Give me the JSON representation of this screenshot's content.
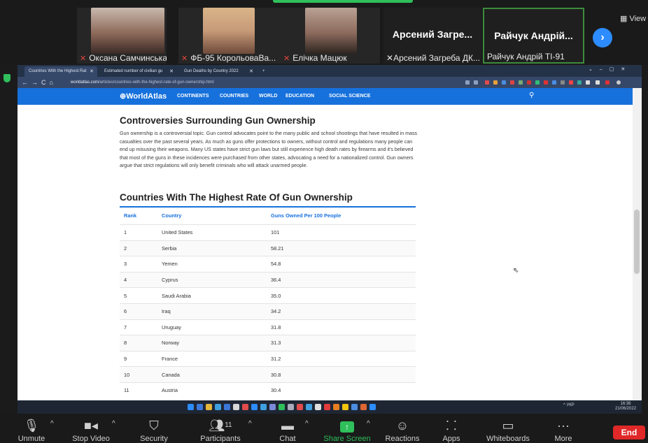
{
  "participants": [
    {
      "name": "Оксана Самчинська",
      "muted": true
    },
    {
      "name": "ФБ-95 КорольоваВа...",
      "muted": true
    },
    {
      "name": "Елічка Мацюк",
      "muted": true
    },
    {
      "name": "Арсений Загреба ДК...",
      "display": "Арсений Загре...",
      "muted": true
    },
    {
      "name": "Райчук Андрій ТІ-91",
      "display": "Райчук Андрій...",
      "muted": false
    }
  ],
  "view_label": "View",
  "browser": {
    "tabs": [
      {
        "label": "Countries With the Highest Rat"
      },
      {
        "label": "Estimated number of civilian gu"
      },
      {
        "label": "Gun Deaths by Country 2022"
      }
    ],
    "new_tab": "+",
    "url_domain": "worldatlas.com",
    "url_path": "/articles/countries-with-the-highest-rate-of-gun-ownership.html"
  },
  "site": {
    "logo": "WorldAtlas",
    "nav": [
      "CONTINENTS",
      "COUNTRIES",
      "WORLD",
      "EDUCATION",
      "SOCIAL SCIENCE"
    ]
  },
  "article": {
    "heading1": "Controversies Surrounding Gun Ownership",
    "paragraph": "Gun ownership is a controversial topic. Gun control advocates point to the many public and school shootings that have resulted in mass casualties over the past several years. As much as guns offer protections to owners, without control and regulations many people can end up misusing their weapons. Many US states have strict gun laws but still experience high death rates by firearms and it's believed that most of the guns in these incidences were purchased from other states, advocating a need for a nationalized control. Gun owners argue that strict regulations will only benefit criminals who will attack unarmed people.",
    "heading2": "Countries With The Highest Rate Of Gun Ownership",
    "table": {
      "headers": [
        "Rank",
        "Country",
        "Guns Owned Per 100 People"
      ],
      "rows": [
        [
          "1",
          "United States",
          "101"
        ],
        [
          "2",
          "Serbia",
          "58.21"
        ],
        [
          "3",
          "Yemen",
          "54.8"
        ],
        [
          "4",
          "Cyprus",
          "36.4"
        ],
        [
          "5",
          "Saudi Arabia",
          "35.0"
        ],
        [
          "6",
          "Iraq",
          "34.2"
        ],
        [
          "7",
          "Uruguay",
          "31.8"
        ],
        [
          "8",
          "Norway",
          "31.3"
        ],
        [
          "9",
          "France",
          "31.2"
        ],
        [
          "10",
          "Canada",
          "30.8"
        ],
        [
          "11",
          "Austria",
          "30.4"
        ]
      ]
    }
  },
  "taskbar": {
    "lang": "УКР",
    "time": "16:38",
    "date": "21/06/2022"
  },
  "toolbar": {
    "unmute": "Unmute",
    "stop_video": "Stop Video",
    "security": "Security",
    "participants": "Participants",
    "participants_count": "11",
    "chat": "Chat",
    "share_screen": "Share Screen",
    "reactions": "Reactions",
    "apps": "Apps",
    "whiteboards": "Whiteboards",
    "more": "More",
    "end": "End"
  },
  "colors": {
    "site_blue": "#1671dc",
    "share_green": "#2fbf5b",
    "end_red": "#e02828",
    "mute_red": "#e2463f"
  }
}
